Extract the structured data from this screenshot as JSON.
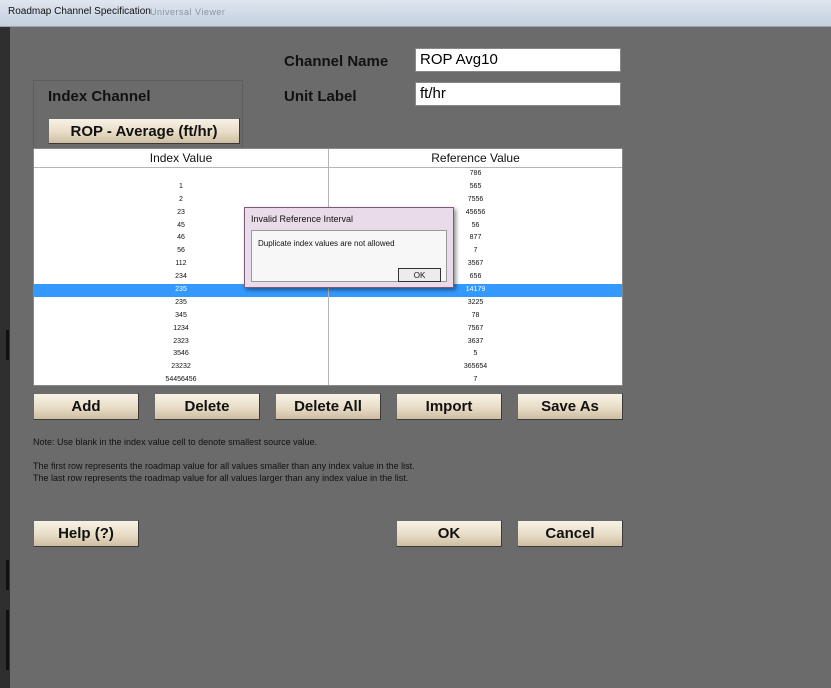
{
  "window": {
    "title": "Roadmap Channel Specification",
    "title_background_text": "Universal Viewer"
  },
  "channel": {
    "name_label": "Channel Name",
    "name_value": "ROP Avg10",
    "unit_label": "Unit Label",
    "unit_value": "ft/hr"
  },
  "index_channel": {
    "label": "Index Channel",
    "button_label": "ROP - Average (ft/hr)"
  },
  "table": {
    "columns": [
      "Index Value",
      "Reference Value"
    ],
    "selected_row": 9,
    "rows": [
      {
        "index": "",
        "ref": "786"
      },
      {
        "index": "1",
        "ref": "565"
      },
      {
        "index": "2",
        "ref": "7556"
      },
      {
        "index": "23",
        "ref": "45656"
      },
      {
        "index": "45",
        "ref": "56"
      },
      {
        "index": "46",
        "ref": "877"
      },
      {
        "index": "56",
        "ref": "7"
      },
      {
        "index": "112",
        "ref": "3567"
      },
      {
        "index": "234",
        "ref": "656"
      },
      {
        "index": "235",
        "ref": "14179"
      },
      {
        "index": "235",
        "ref": "3225"
      },
      {
        "index": "345",
        "ref": "78"
      },
      {
        "index": "1234",
        "ref": "7567"
      },
      {
        "index": "2323",
        "ref": "3637"
      },
      {
        "index": "3546",
        "ref": "5"
      },
      {
        "index": "23232",
        "ref": "365654"
      },
      {
        "index": "54456456",
        "ref": "7"
      }
    ]
  },
  "actions": {
    "add": "Add",
    "delete": "Delete",
    "delete_all": "Delete All",
    "import": "Import",
    "save_as": "Save As"
  },
  "notes": {
    "note1": "Note: Use blank in the index value cell to denote smallest source value.",
    "note2": "The first row represents the roadmap value for all values smaller than any index value in the list.",
    "note3": "The last row represents the roadmap value for all values larger than any index value in the list."
  },
  "footer": {
    "help": "Help (?)",
    "ok": "OK",
    "cancel": "Cancel"
  },
  "dialog": {
    "title": "Invalid Reference Interval",
    "message": "Duplicate index values are not allowed",
    "ok": "OK"
  },
  "colors": {
    "background": "#6b6b6b",
    "selection": "#3399ff",
    "button_face": "#e8dcc6"
  }
}
